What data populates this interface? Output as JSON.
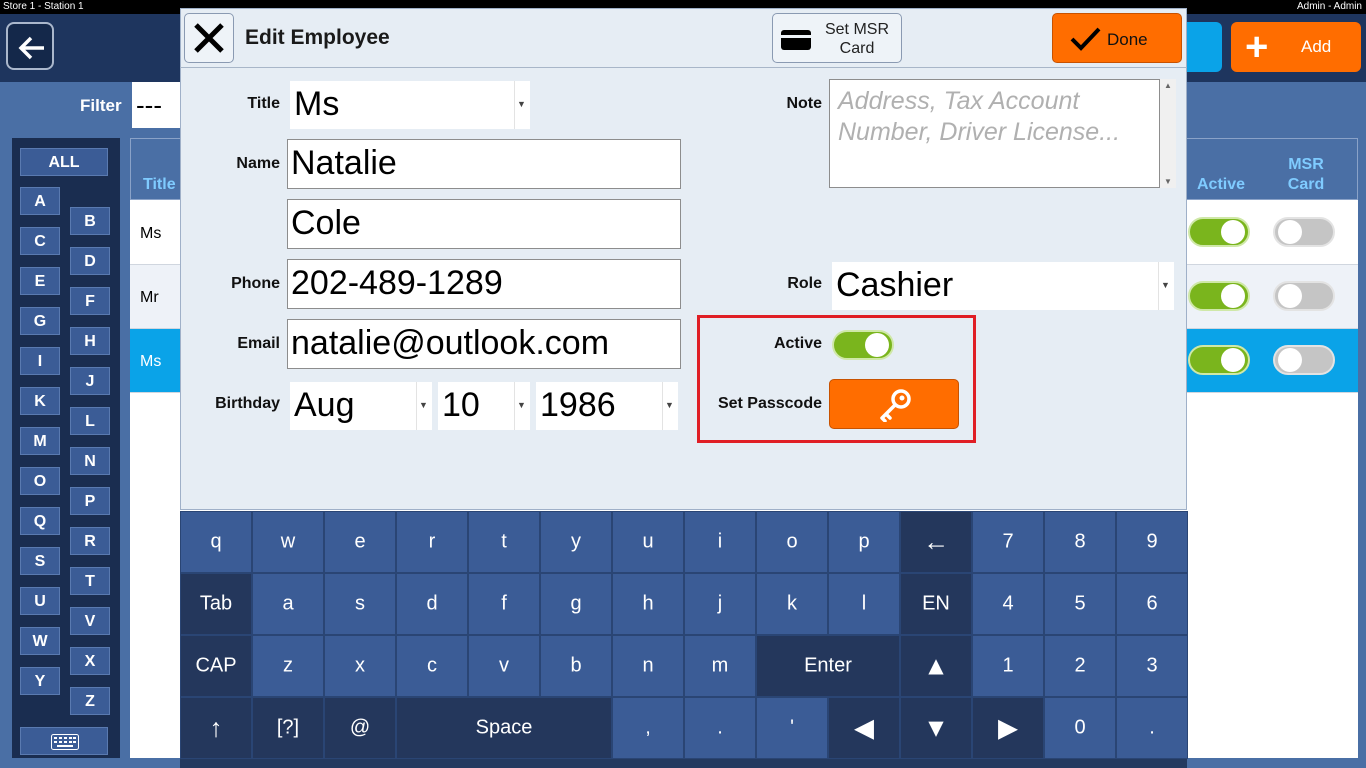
{
  "system_bar": {
    "left": "Store 1 - Station 1",
    "right": "Admin - Admin"
  },
  "background": {
    "add_label": "Add",
    "filter_label": "Filter",
    "filter_value": "---",
    "alphabet": {
      "all": "ALL",
      "left_col": [
        "A",
        "C",
        "E",
        "G",
        "I",
        "K",
        "M",
        "O",
        "Q",
        "S",
        "U",
        "W",
        "Y"
      ],
      "right_col": [
        "B",
        "D",
        "F",
        "H",
        "J",
        "L",
        "N",
        "P",
        "R",
        "T",
        "V",
        "X",
        "Z"
      ]
    },
    "columns": {
      "title": "Title",
      "active": "Active",
      "msr_card": "MSR Card"
    },
    "rows": [
      {
        "title": "Ms",
        "active": true,
        "msr": false
      },
      {
        "title": "Mr",
        "active": true,
        "msr": false
      },
      {
        "title": "Ms",
        "active": true,
        "msr": false
      }
    ]
  },
  "dialog": {
    "title": "Edit Employee",
    "msr_button": "Set MSR Card",
    "done_button": "Done",
    "labels": {
      "title": "Title",
      "name": "Name",
      "phone": "Phone",
      "email": "Email",
      "birthday": "Birthday",
      "note": "Note",
      "role": "Role",
      "active": "Active",
      "set_passcode": "Set Passcode"
    },
    "values": {
      "title": "Ms",
      "first_name": "Natalie",
      "last_name": "Cole",
      "phone": "202-489-1289",
      "email": "natalie@outlook.com",
      "birth_month": "Aug",
      "birth_day": "10",
      "birth_year": "1986",
      "role": "Cashier",
      "active": true
    },
    "note_placeholder": "Address, Tax Account Number, Driver License..."
  },
  "keyboard": {
    "row1": [
      "q",
      "w",
      "e",
      "r",
      "t",
      "y",
      "u",
      "i",
      "o",
      "p",
      "←",
      "7",
      "8",
      "9"
    ],
    "row2": [
      "Tab",
      "a",
      "s",
      "d",
      "f",
      "g",
      "h",
      "j",
      "k",
      "l",
      "EN",
      "4",
      "5",
      "6"
    ],
    "row3": [
      "CAP",
      "z",
      "x",
      "c",
      "v",
      "b",
      "n",
      "m",
      "Enter",
      "▲",
      "1",
      "2",
      "3"
    ],
    "row4": [
      "↑",
      "[?]",
      "@",
      "Space",
      ",",
      ".",
      "'",
      "◀",
      "▼",
      "▶",
      "0",
      "."
    ]
  },
  "colors": {
    "accent": "#ff6d00",
    "toggle_on": "#7ab51d",
    "highlight": "#e01e25",
    "selected_row": "#0aa3e8"
  },
  "icons": [
    "back-arrow-icon",
    "plus-icon",
    "close-icon",
    "card-icon",
    "checkmark-icon",
    "key-icon",
    "keyboard-icon"
  ]
}
